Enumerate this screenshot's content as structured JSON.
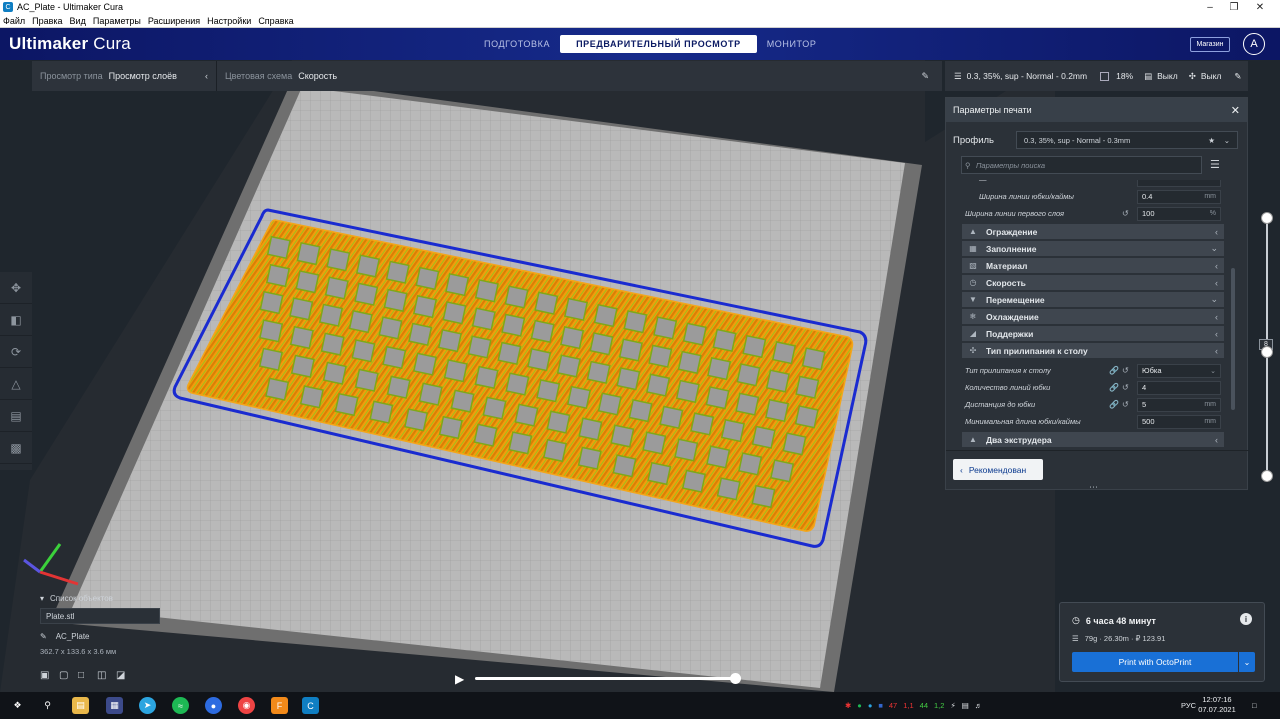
{
  "window": {
    "title": "AC_Plate - Ultimaker Cura",
    "app_icon": "C"
  },
  "menu": [
    "Файл",
    "Правка",
    "Вид",
    "Параметры",
    "Расширения",
    "Настройки",
    "Справка"
  ],
  "header": {
    "logo_bold": "Ultimaker",
    "logo_light": "Cura",
    "tabs": [
      "ПОДГОТОВКА",
      "ПРЕДВАРИТЕЛЬНЫЙ ПРОСМОТР",
      "МОНИТОР"
    ],
    "active_tab": 1,
    "marketplace": "Магазин",
    "account_initial": "A"
  },
  "viewbar": {
    "view_type_label": "Просмотр типа",
    "view_type_value": "Просмотр слоёв",
    "color_scheme_label": "Цветовая схема",
    "color_scheme_value": "Скорость"
  },
  "summary": {
    "profile": "0.3, 35%, sup - Normal - 0.2mm",
    "infill": "18%",
    "support": "Выкл",
    "adhesion": "Выкл"
  },
  "print_settings": {
    "title": "Параметры печати",
    "profile_label": "Профиль",
    "profile_value": "0.3, 35%, sup - Normal - 0.3mm",
    "search_placeholder": "Параметры поиска",
    "rows": [
      {
        "name": "Ширина линии юбки/каймы",
        "value": "0.4",
        "unit": "mm",
        "indent": 2
      },
      {
        "name": "Ширина линии первого слоя",
        "value": "100",
        "unit": "%",
        "indent": 1
      }
    ],
    "categories": [
      "Ограждение",
      "Заполнение",
      "Материал",
      "Скорость",
      "Перемещение",
      "Охлаждение",
      "Поддержки",
      "Тип прилипания к столу"
    ],
    "adhesion_rows": [
      {
        "name": "Тип прилипания к столу",
        "value": "Юбка",
        "unit": ""
      },
      {
        "name": "Количество линий юбки",
        "value": "4",
        "unit": ""
      },
      {
        "name": "Дистанция до юбки",
        "value": "5",
        "unit": "mm"
      },
      {
        "name": "Минимальная длина юбки/каймы",
        "value": "500",
        "unit": "mm"
      }
    ],
    "last_category": "Два экструдера",
    "recommended_button": "Рекомендован"
  },
  "layer_slider": {
    "current_layer": "8",
    "top_fraction": 0.0,
    "current_fraction": 0.53
  },
  "objects": {
    "header": "Список объектов",
    "file": "Plate.stl",
    "object_name": "AC_Plate",
    "dimensions": "362.7 x 133.6 x 3.6 мм"
  },
  "playback": {
    "progress_fraction": 1.0
  },
  "print_info": {
    "time": "6 часа 48 минут",
    "material": "79g · 26.30m · ₽ 123.91",
    "button": "Print with OctoPrint"
  },
  "taskbar": {
    "time": "12:07:16",
    "date": "07.07.2021",
    "lang": "РУС",
    "tray_nums": [
      "47",
      "1,1",
      "44",
      "1,2"
    ]
  },
  "colors": {
    "header_blue": "#0c1664",
    "accent": "#1970d6",
    "skirt": "#1a2bd0",
    "infill_orange": "#f39a0c"
  }
}
